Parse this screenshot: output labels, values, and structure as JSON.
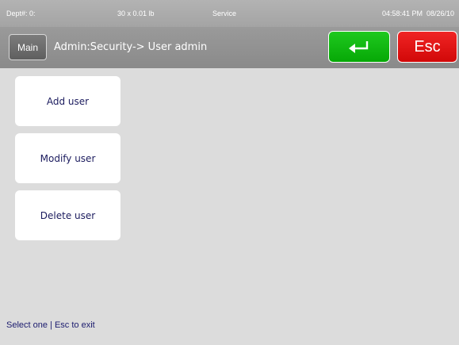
{
  "status_bar": {
    "dept": "Dept#: 0:",
    "weight": "30 x 0.01 lb",
    "mode": "Service",
    "time": "04:58:41 PM",
    "date": "08/26/10"
  },
  "title_bar": {
    "main_label": "Main",
    "breadcrumb": "Admin:Security-> User admin",
    "enter_icon": "enter-return-arrow-icon",
    "esc_label": "Esc"
  },
  "menu": {
    "items": [
      {
        "label": "Add user"
      },
      {
        "label": "Modify user"
      },
      {
        "label": "Delete user"
      }
    ]
  },
  "footer": {
    "hint": "Select one | Esc to exit"
  },
  "colors": {
    "enter": "#0fb90f",
    "esc": "#e31414",
    "header": "#939393",
    "background": "#dcdcdc"
  }
}
